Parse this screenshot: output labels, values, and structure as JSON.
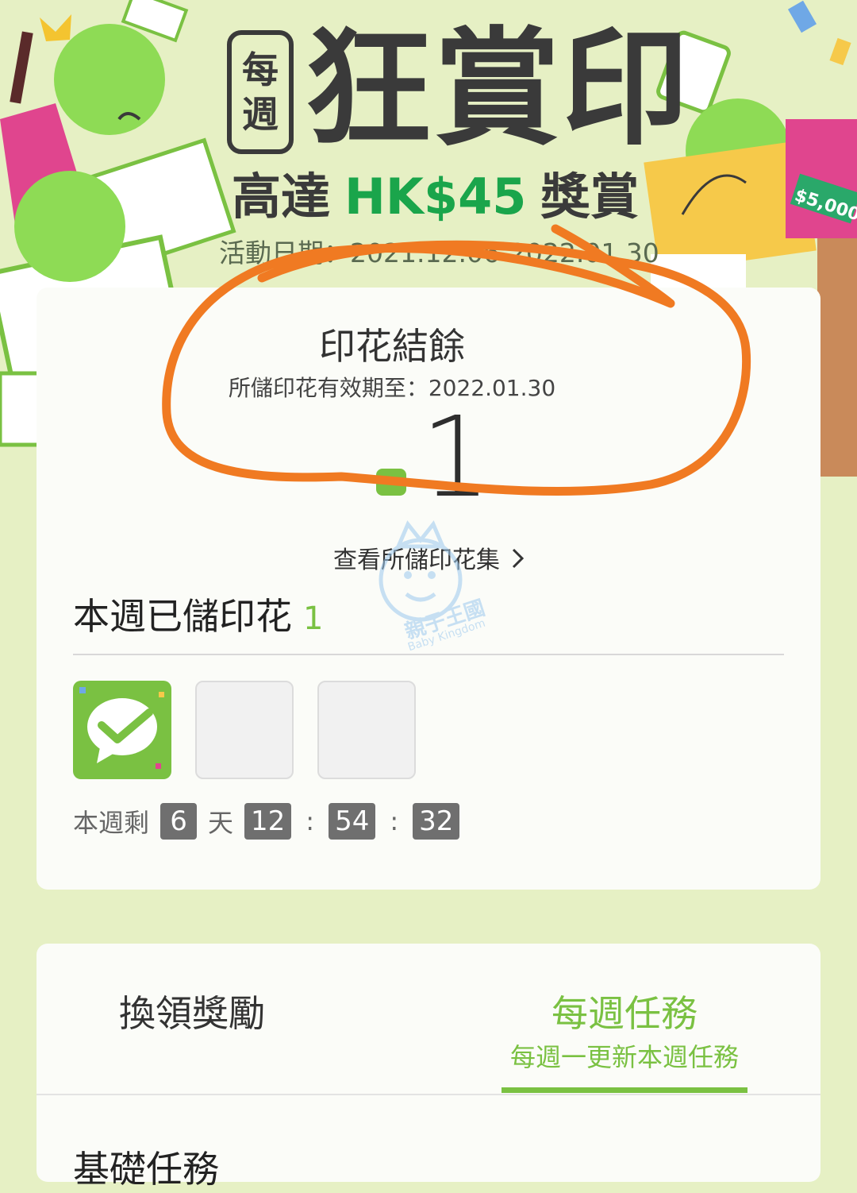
{
  "banner": {
    "logo_top": "每",
    "logo_bottom": "週",
    "title": "狂賞印",
    "reward_prefix": "高達",
    "reward_amount": "HK$45",
    "reward_suffix": "獎賞",
    "event_date": "活動日期：2021.12.06-2022.01.30",
    "price_tag": "$5,000"
  },
  "balance": {
    "title": "印花結餘",
    "validity": "所儲印花有效期至：2022.01.30",
    "count": "1",
    "view_link": "查看所儲印花集"
  },
  "weekly": {
    "title": "本週已儲印花",
    "count": "1",
    "slots": [
      {
        "state": "filled",
        "icon": "check-bubble-icon"
      },
      {
        "state": "empty"
      },
      {
        "state": "empty"
      }
    ]
  },
  "countdown": {
    "prefix": "本週剩",
    "days": "6",
    "days_unit": "天",
    "hours": "12",
    "minutes": "54",
    "seconds": "32",
    "separator": ":"
  },
  "tabs": {
    "redeem_label": "換領獎勵",
    "weekly_tasks_label": "每週任務",
    "weekly_tasks_sub": "每週一更新本週任務"
  },
  "section_heading": "基礎任務",
  "watermark": {
    "name": "親子王國",
    "subtitle": "Baby Kingdom"
  },
  "colors": {
    "background": "#e6f0c4",
    "accent_green": "#7ac142",
    "amount_green": "#1aa54b",
    "annotation_orange": "#f07a22",
    "timer_box": "#6f6f6f"
  }
}
